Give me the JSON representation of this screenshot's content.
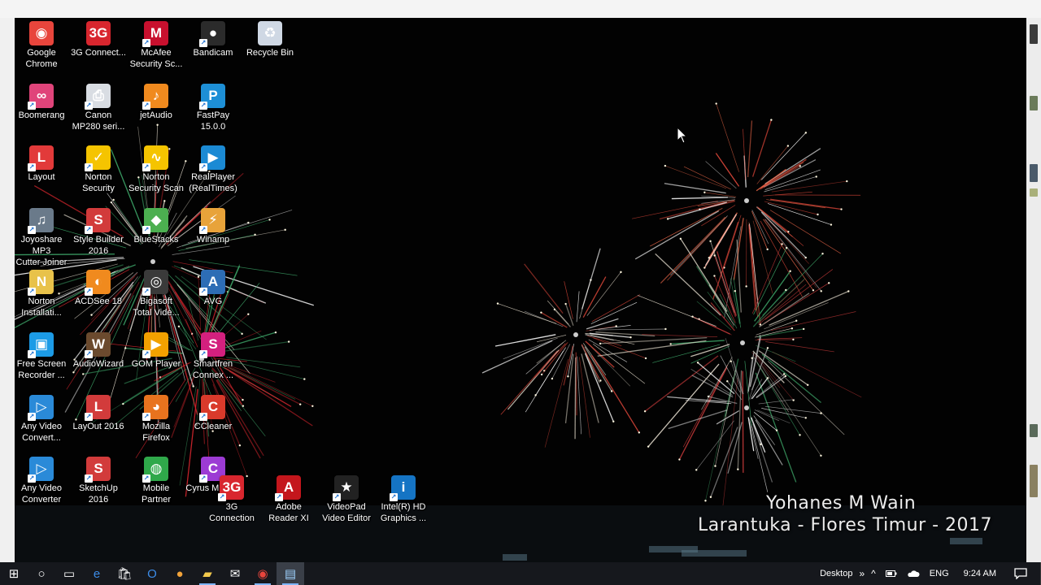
{
  "desktop": {
    "icons": [
      {
        "label": "Google\nChrome",
        "icon": "chrome-icon",
        "color": "#e8453c"
      },
      {
        "label": "3G Connect...",
        "icon": "3g-connect-icon",
        "color": "#d8262e"
      },
      {
        "label": "McAfee\nSecurity Sc...",
        "icon": "mcafee-icon",
        "color": "#c8102e"
      },
      {
        "label": "Bandicam",
        "icon": "bandicam-icon",
        "color": "#2b2b2b"
      },
      {
        "label": "Recycle Bin",
        "icon": "recycle-bin-icon",
        "color": "#cfd8e4"
      },
      {
        "label": "Boomerang",
        "icon": "boomerang-icon",
        "color": "#e0447a"
      },
      {
        "label": "Canon\nMP280 seri...",
        "icon": "canon-printer-icon",
        "color": "#d9dde3"
      },
      {
        "label": "jetAudio",
        "icon": "jetaudio-icon",
        "color": "#f08a1e"
      },
      {
        "label": "FastPay\n15.0.0",
        "icon": "fastpay-icon",
        "color": "#1d8fd6"
      },
      {
        "label": "Layout",
        "icon": "layout-icon",
        "color": "#e23a3a"
      },
      {
        "label": "Norton\nSecurity",
        "icon": "norton-security-icon",
        "color": "#f5c400"
      },
      {
        "label": "Norton\nSecurity Scan",
        "icon": "norton-scan-icon",
        "color": "#f5c400"
      },
      {
        "label": "RealPlayer\n(RealTimes)",
        "icon": "realplayer-icon",
        "color": "#1b8ad4"
      },
      {
        "label": "Joyoshare MP3\nCutter Joiner",
        "icon": "mp3-cutter-icon",
        "color": "#6a7a8a"
      },
      {
        "label": "Style Builder\n2016",
        "icon": "style-builder-icon",
        "color": "#d23b3b"
      },
      {
        "label": "BlueStacks",
        "icon": "bluestacks-icon",
        "color": "#4caf50"
      },
      {
        "label": "Winamp",
        "icon": "winamp-icon",
        "color": "#e8a33a"
      },
      {
        "label": "Norton\nInstallati...",
        "icon": "norton-installer-icon",
        "color": "#e8c24a"
      },
      {
        "label": "ACDSee 18",
        "icon": "acdsee-icon",
        "color": "#f08a1e"
      },
      {
        "label": "Bigasoft\nTotal Vide...",
        "icon": "bigasoft-icon",
        "color": "#3a3a3a"
      },
      {
        "label": "AVG",
        "icon": "avg-icon",
        "color": "#2d6db5"
      },
      {
        "label": "Free Screen\nRecorder ...",
        "icon": "screen-recorder-icon",
        "color": "#1c9be6"
      },
      {
        "label": "AudioWizard",
        "icon": "audiowizard-icon",
        "color": "#6b4a2e"
      },
      {
        "label": "GOM Player",
        "icon": "gom-player-icon",
        "color": "#f2a100"
      },
      {
        "label": "Smartfren\nConnex ...",
        "icon": "smartfren-icon",
        "color": "#d4207e"
      },
      {
        "label": "Any Video\nConvert...",
        "icon": "any-video-icon",
        "color": "#2a8ad8"
      },
      {
        "label": "LayOut 2016",
        "icon": "layout-2016-icon",
        "color": "#d23b3b"
      },
      {
        "label": "Mozilla\nFirefox",
        "icon": "firefox-icon",
        "color": "#e8731e"
      },
      {
        "label": "CCleaner",
        "icon": "ccleaner-icon",
        "color": "#d93a2b"
      },
      {
        "label": "Any Video\nConverter",
        "icon": "any-video-converter-icon",
        "color": "#2a8ad8"
      },
      {
        "label": "SketchUp\n2016",
        "icon": "sketchup-icon",
        "color": "#d23b3b"
      },
      {
        "label": "Mobile\nPartner",
        "icon": "mobile-partner-icon",
        "color": "#2fa84a"
      },
      {
        "label": "Cyrus MC400",
        "icon": "cyrus-icon",
        "color": "#9c3bd4"
      },
      {
        "label": "3G\nConnection",
        "icon": "3g-connection-icon",
        "color": "#d8262e"
      },
      {
        "label": "Adobe\nReader XI",
        "icon": "adobe-reader-icon",
        "color": "#c4161c"
      },
      {
        "label": "VideoPad\nVideo Editor",
        "icon": "videopad-icon",
        "color": "#222222"
      },
      {
        "label": "Intel(R) HD\nGraphics ...",
        "icon": "intel-graphics-icon",
        "color": "#1574c4"
      }
    ],
    "watermark": {
      "line1": "Yohanes M Wain",
      "line2": "Larantuka - Flores Timur - 2017"
    }
  },
  "taskbar": {
    "buttons": [
      {
        "icon": "windows-start-icon",
        "glyph": "⊞"
      },
      {
        "icon": "cortana-icon",
        "glyph": "○"
      },
      {
        "icon": "task-view-icon",
        "glyph": "▭"
      },
      {
        "icon": "edge-icon",
        "glyph": "e"
      },
      {
        "icon": "store-icon",
        "glyph": "🛍"
      },
      {
        "icon": "outlook-icon",
        "glyph": "O"
      },
      {
        "icon": "app-orange-icon",
        "glyph": "●"
      },
      {
        "icon": "file-explorer-icon",
        "glyph": "▰"
      },
      {
        "icon": "mail-icon",
        "glyph": "✉"
      },
      {
        "icon": "chrome-taskbar-icon",
        "glyph": "◉"
      },
      {
        "icon": "notepad-icon",
        "glyph": "▤"
      }
    ],
    "tray": {
      "desktop_label": "Desktop",
      "chevron": "»",
      "up_arrow": "^",
      "language": "ENG",
      "time": "9:24 AM"
    }
  }
}
